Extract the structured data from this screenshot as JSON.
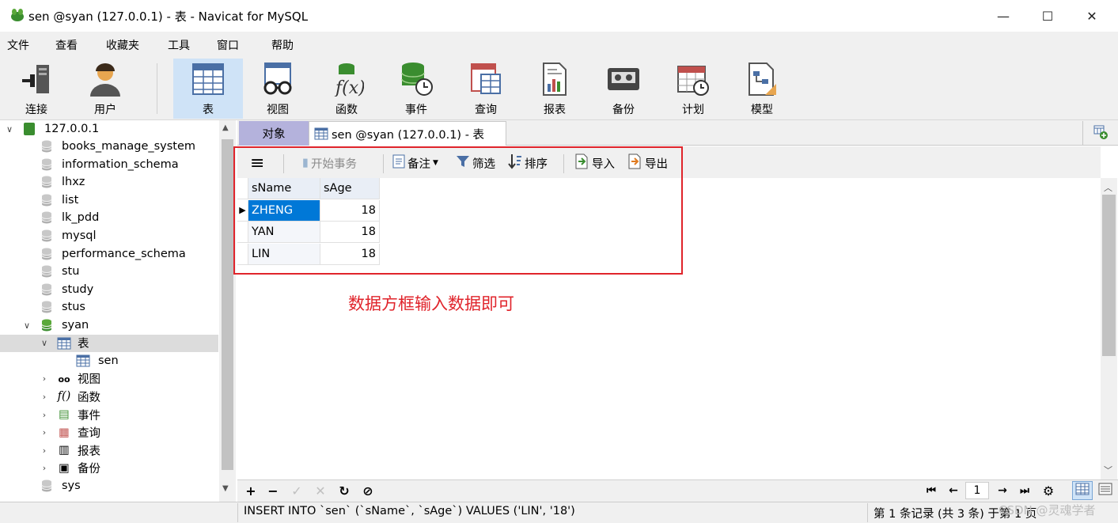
{
  "window": {
    "title": "sen @syan (127.0.0.1) - 表 - Navicat for MySQL",
    "minimize": "—",
    "maximize": "☐",
    "close": "✕"
  },
  "menu": [
    "文件",
    "查看",
    "收藏夹",
    "工具",
    "窗口",
    "帮助"
  ],
  "ribbon": [
    {
      "label": "连接",
      "icon": "connection-icon"
    },
    {
      "label": "用户",
      "icon": "user-icon"
    },
    {
      "label": "表",
      "icon": "table-icon"
    },
    {
      "label": "视图",
      "icon": "view-icon"
    },
    {
      "label": "函数",
      "icon": "function-icon"
    },
    {
      "label": "事件",
      "icon": "event-icon"
    },
    {
      "label": "查询",
      "icon": "query-icon"
    },
    {
      "label": "报表",
      "icon": "report-icon"
    },
    {
      "label": "备份",
      "icon": "backup-icon"
    },
    {
      "label": "计划",
      "icon": "schedule-icon"
    },
    {
      "label": "模型",
      "icon": "model-icon"
    }
  ],
  "sidebar": {
    "connection": "127.0.0.1",
    "databases": [
      "books_manage_system",
      "information_schema",
      "lhxz",
      "list",
      "lk_pdd",
      "mysql",
      "performance_schema",
      "stu",
      "study",
      "stus"
    ],
    "open_db": "syan",
    "tables_node": "表",
    "table": "sen",
    "subnodes": [
      "视图",
      "函数",
      "事件",
      "查询",
      "报表",
      "备份"
    ],
    "after": [
      "sys"
    ]
  },
  "tabs": {
    "objects": "对象",
    "table_tab": "sen @syan (127.0.0.1) - 表"
  },
  "toolbar": {
    "menu": "≡",
    "begin_tx": "开始事务",
    "note": "备注",
    "filter": "筛选",
    "sort": "排序",
    "import": "导入",
    "export": "导出"
  },
  "grid": {
    "columns": [
      "sName",
      "sAge"
    ],
    "rows": [
      [
        "ZHENG",
        "18"
      ],
      [
        "YAN",
        "18"
      ],
      [
        "LIN",
        "18"
      ]
    ]
  },
  "annotation": "数据方框输入数据即可",
  "pager": {
    "page": "1"
  },
  "status": {
    "sql": "INSERT INTO `sen` (`sName`, `sAge`) VALUES ('LIN', '18')",
    "records": "第 1 条记录 (共 3 条) 于第 1 页"
  },
  "watermark": "CSDN @灵魂学者",
  "colors": {
    "selected": "#0078d7",
    "annotation": "#e0242b",
    "objects_tab": "#b4b2dc"
  }
}
